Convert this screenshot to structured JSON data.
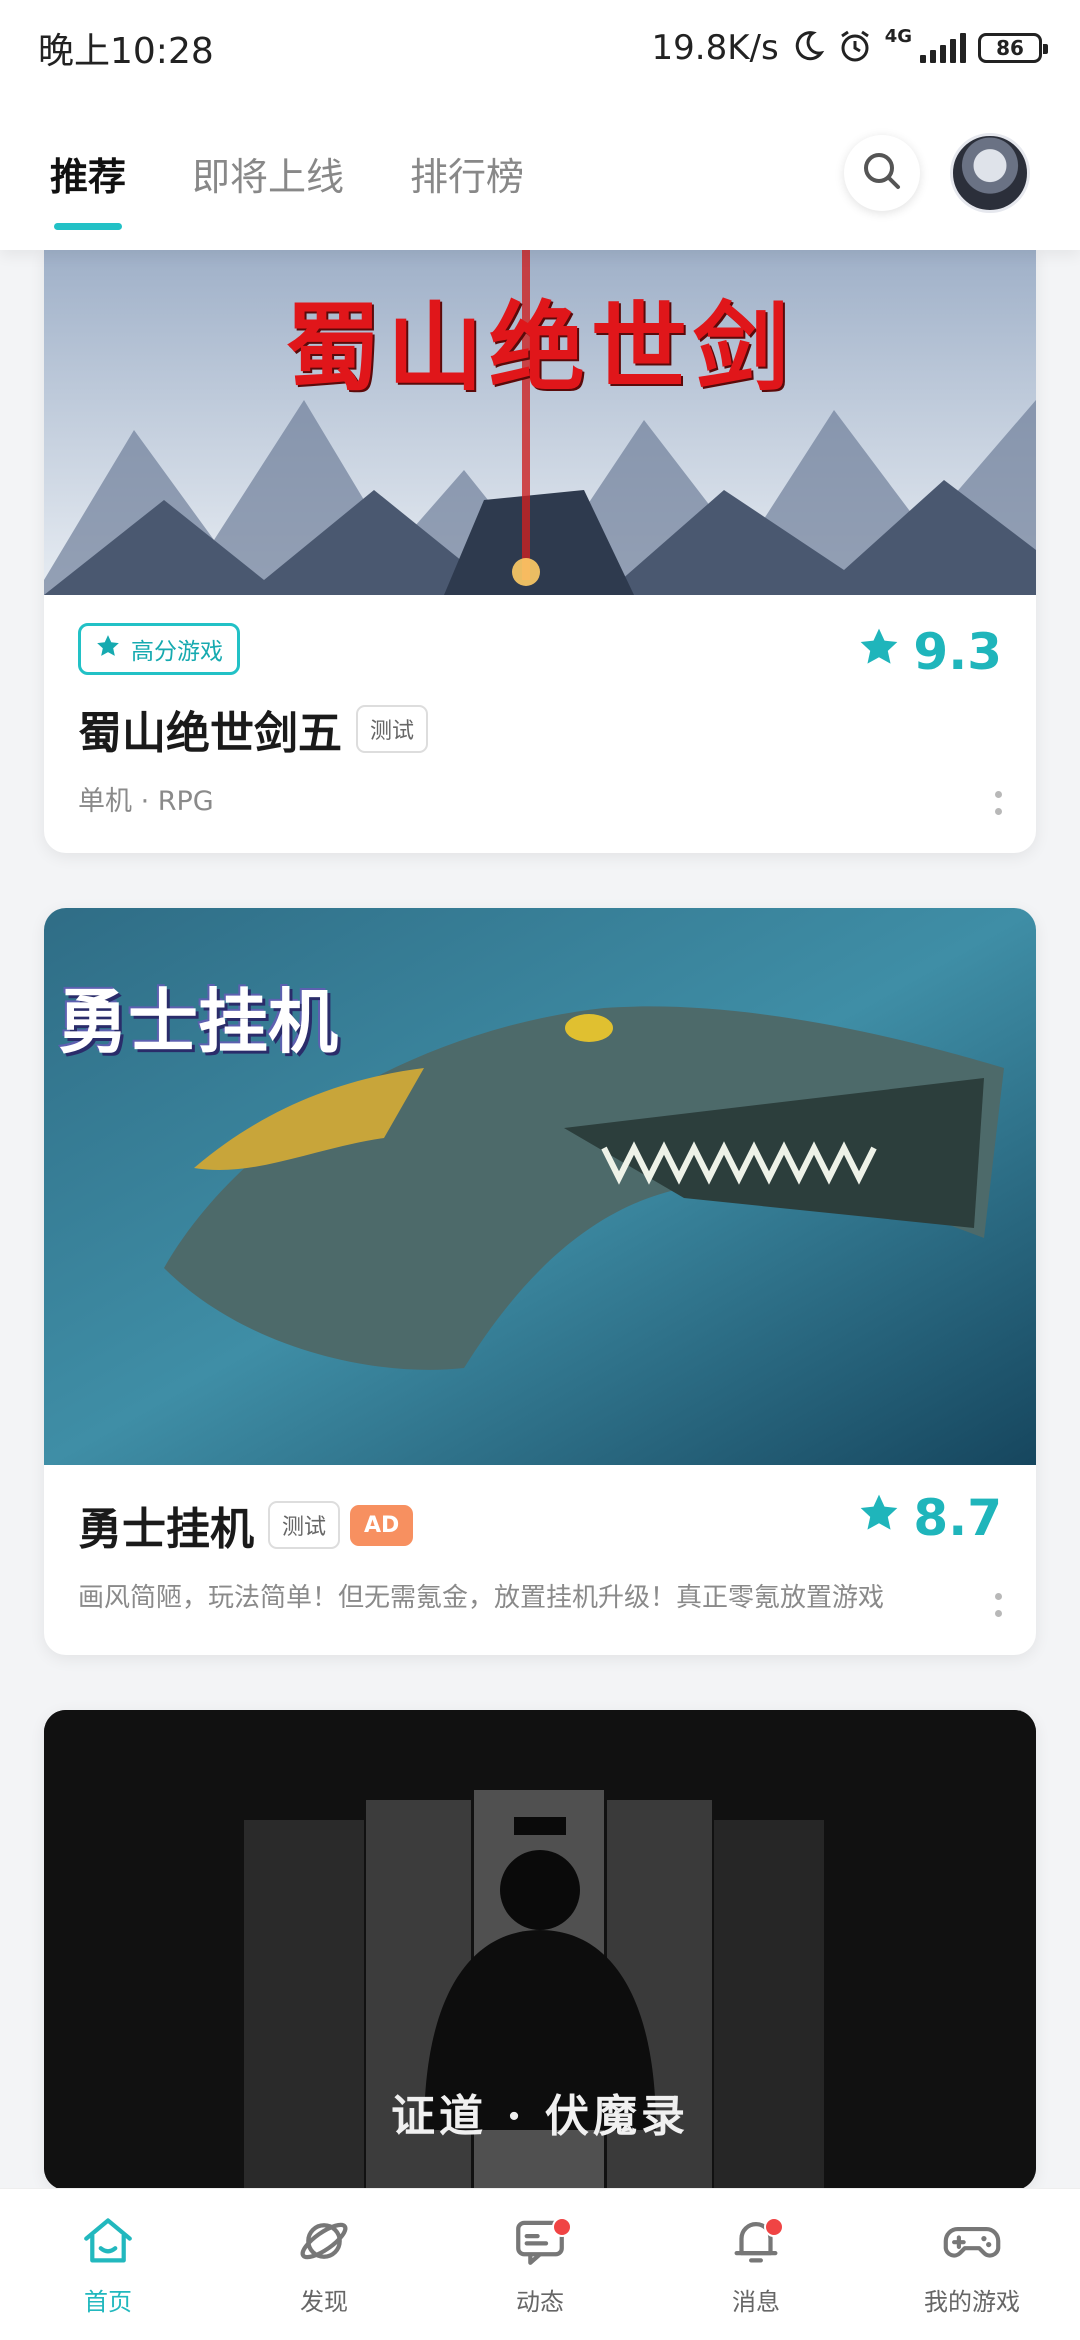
{
  "status_bar": {
    "time": "晚上10:28",
    "net_speed": "19.8K/s",
    "network_type": "4G",
    "battery": "86"
  },
  "header": {
    "tabs": [
      {
        "label": "推荐",
        "active": true
      },
      {
        "label": "即将上线",
        "active": false
      },
      {
        "label": "排行榜",
        "active": false
      }
    ],
    "search_icon": "search-icon",
    "avatar": "user-avatar"
  },
  "cards": [
    {
      "banner_text": "蜀山绝世剑",
      "badge": "高分游戏",
      "title": "蜀山绝世剑五",
      "test_tag": "测试",
      "meta": "单机 · RPG",
      "rating": "9.3"
    },
    {
      "banner_text": "勇士挂机",
      "title": "勇士挂机",
      "test_tag": "测试",
      "ad_tag": "AD",
      "description": "画风简陋，玩法简单！但无需氪金，放置挂机升级！真正零氪放置游戏",
      "rating": "8.7"
    },
    {
      "banner_text": "证道 · 伏魔录"
    }
  ],
  "bottom_nav": [
    {
      "label": "首页",
      "icon": "home-icon",
      "active": true,
      "badge": false
    },
    {
      "label": "发现",
      "icon": "planet-icon",
      "active": false,
      "badge": false
    },
    {
      "label": "动态",
      "icon": "chat-icon",
      "active": false,
      "badge": true
    },
    {
      "label": "消息",
      "icon": "bell-icon",
      "active": false,
      "badge": true
    },
    {
      "label": "我的游戏",
      "icon": "gamepad-icon",
      "active": false,
      "badge": false
    }
  ],
  "colors": {
    "accent": "#22c1c6",
    "ad": "#f79060",
    "badge_dot": "#f04444"
  }
}
